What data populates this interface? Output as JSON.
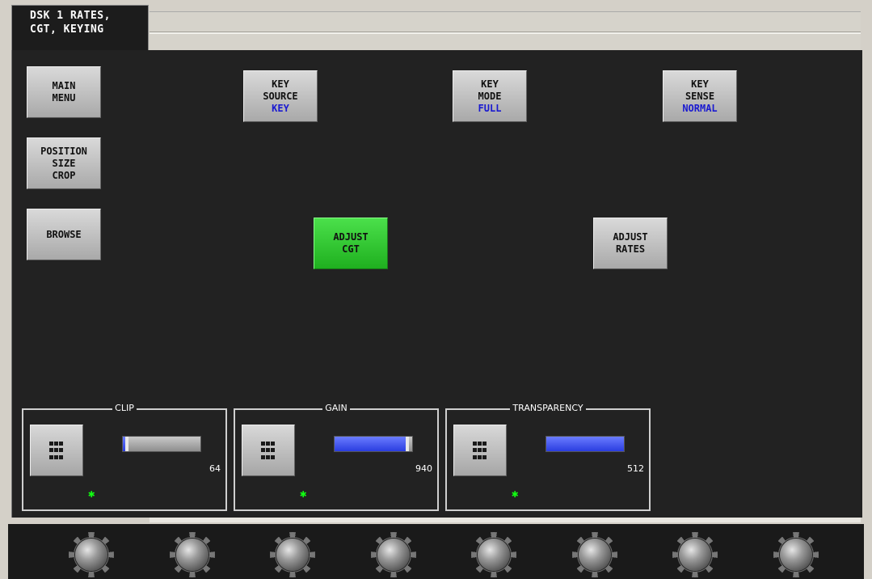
{
  "window": {
    "tab_title_line1": "DSK 1 RATES,",
    "tab_title_line2": "CGT, KEYING"
  },
  "nav": {
    "main_menu": [
      "MAIN",
      "MENU"
    ],
    "position_size_crop": [
      "POSITION",
      "SIZE",
      "CROP"
    ],
    "browse": "BROWSE"
  },
  "controls": {
    "key_source": {
      "label1": "KEY",
      "label2": "SOURCE",
      "value": "KEY"
    },
    "key_mode": {
      "label1": "KEY",
      "label2": "MODE",
      "value": "FULL"
    },
    "key_sense": {
      "label1": "KEY",
      "label2": "SENSE",
      "value": "NORMAL"
    },
    "adjust_cgt": [
      "ADJUST",
      "CGT"
    ],
    "adjust_rates": [
      "ADJUST",
      "RATES"
    ]
  },
  "params": [
    {
      "title": "CLIP",
      "value": "64",
      "fill_fraction": 0.03
    },
    {
      "title": "GAIN",
      "value": "940",
      "fill_fraction": 0.92
    },
    {
      "title": "TRANSPARENCY",
      "value": "512",
      "fill_fraction": 1.0
    }
  ],
  "colors": {
    "value_text": "#1a1ad0",
    "active_button": "#2ec82e",
    "indicator_star": "#11ff11",
    "slider_fill": "#3a4cf0"
  },
  "icons": {
    "keypad": "keypad-icon",
    "indicator": "star-indicator-icon",
    "knob": "knob-icon"
  }
}
